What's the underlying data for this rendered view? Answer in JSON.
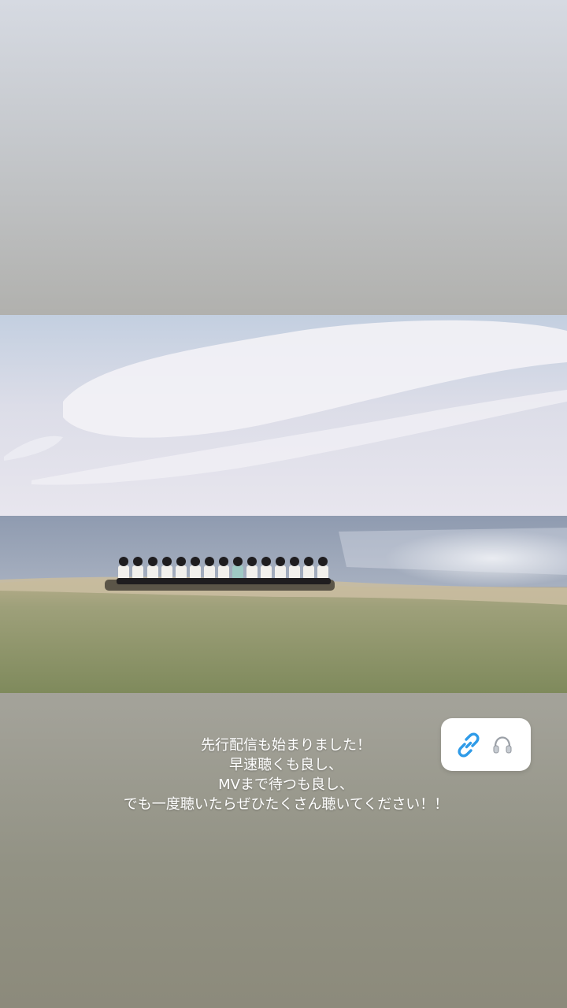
{
  "caption": {
    "lines": [
      "先行配信も始まりました！",
      "早速聴くも良し、",
      "MVまで待つも良し、",
      "でも一度聴いたらぜひたくさん聴いてください！！"
    ]
  },
  "sticker": {
    "icons": [
      "link-icon",
      "headphones-icon"
    ],
    "link_color": "#2f9be8",
    "background": "#ffffff"
  },
  "photo": {
    "icon": "beach-group-photo"
  },
  "colors": {
    "background_top": "#d6dae2",
    "background_bottom": "#8c8a7b",
    "caption_text": "#ffffff"
  }
}
